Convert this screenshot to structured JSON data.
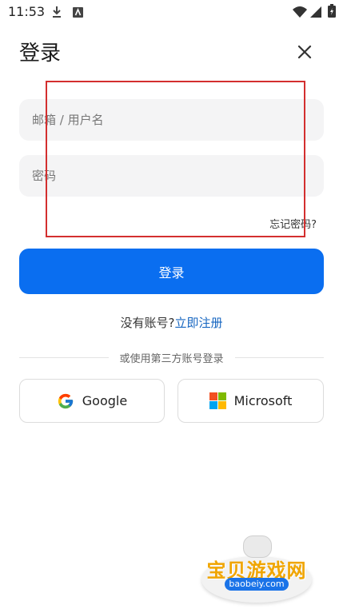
{
  "status_bar": {
    "time": "11:53"
  },
  "header": {
    "title": "登录",
    "close_icon": "close-icon"
  },
  "form": {
    "email_placeholder": "邮箱 / 用户名",
    "email_value": "",
    "password_placeholder": "密码",
    "password_value": "",
    "forgot_label": "忘记密码?",
    "submit_label": "登录"
  },
  "register": {
    "prompt": "没有账号?",
    "link": "立即注册"
  },
  "divider_text": "或使用第三方账号登录",
  "social": [
    {
      "label": "Google",
      "icon": "google-icon"
    },
    {
      "label": "Microsoft",
      "icon": "microsoft-icon"
    }
  ],
  "watermark": {
    "title": "宝贝游戏网",
    "url": "baobeiy.com"
  },
  "colors": {
    "primary": "#0a6ef0",
    "link": "#1565c0",
    "field_bg": "#f4f4f5",
    "highlight": "#d32f2f"
  }
}
